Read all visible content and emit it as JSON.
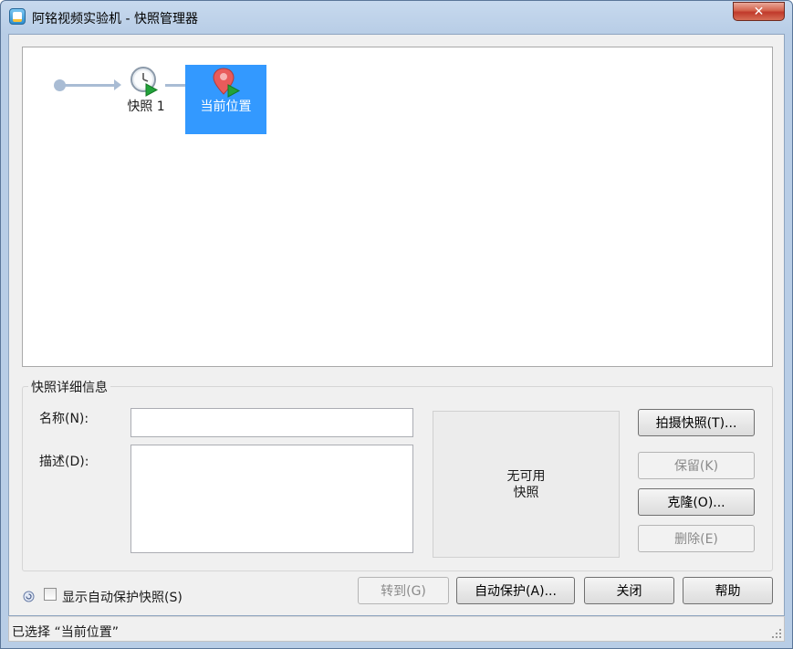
{
  "window": {
    "title": "阿铭视频实验机 - 快照管理器",
    "close_glyph": "✕"
  },
  "tree": {
    "snapshot_label": "快照 1",
    "current_label": "当前位置",
    "selected_color": "#3399ff"
  },
  "details": {
    "legend": "快照详细信息",
    "name_label": "名称(N):",
    "name_value": "",
    "description_label": "描述(D):",
    "description_value": "",
    "preview_line1": "无可用",
    "preview_line2": "快照"
  },
  "buttons": {
    "take_snapshot": "拍摄快照(T)...",
    "keep": "保留(K)",
    "clone": "克隆(O)...",
    "delete": "删除(E)",
    "goto": "转到(G)",
    "autoprotect": "自动保护(A)...",
    "close": "关闭",
    "help": "帮助"
  },
  "options": {
    "show_autoprotect_label": "显示自动保护快照(S)",
    "show_autoprotect_checked": false
  },
  "status": {
    "text": "已选择 “当前位置”"
  }
}
